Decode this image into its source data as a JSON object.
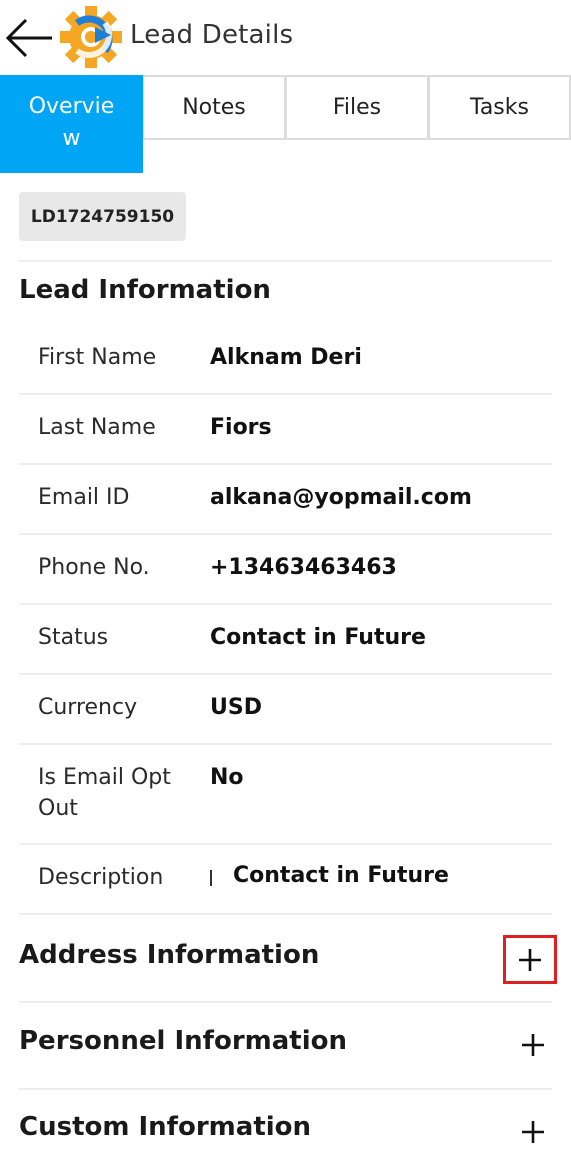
{
  "header": {
    "title": "Lead Details",
    "back_icon": "arrow-left-icon",
    "logo_icon": "gear-logo-icon",
    "logo_colors": {
      "gear": "#1f7fd8",
      "dot": "#f5a623"
    }
  },
  "tabs": [
    {
      "label": "Overvie\nw",
      "active": true
    },
    {
      "label": "Notes",
      "active": false
    },
    {
      "label": "Files",
      "active": false
    },
    {
      "label": "Tasks",
      "active": false
    }
  ],
  "lead_id": "LD1724759150",
  "lead_information": {
    "title": "Lead Information",
    "fields": [
      {
        "label": "First Name",
        "value": "Alknam Deri"
      },
      {
        "label": "Last Name",
        "value": "Fiors"
      },
      {
        "label": "Email ID",
        "value": "alkana@yopmail.com"
      },
      {
        "label": "Phone No.",
        "value": "+13463463463"
      },
      {
        "label": "Status",
        "value": "Contact in Future"
      },
      {
        "label": "Currency",
        "value": "USD"
      },
      {
        "label": "Is Email Opt Out",
        "value": "No"
      },
      {
        "label": "Description",
        "value": "Contact in Future"
      }
    ]
  },
  "sections": [
    {
      "title": "Address Information",
      "icon": "plus-icon",
      "highlighted": true
    },
    {
      "title": "Personnel Information",
      "icon": "plus-icon",
      "highlighted": false
    },
    {
      "title": "Custom Information",
      "icon": "plus-icon",
      "highlighted": false
    }
  ],
  "colors": {
    "accent": "#00a6f5",
    "highlight": "#e02020"
  }
}
